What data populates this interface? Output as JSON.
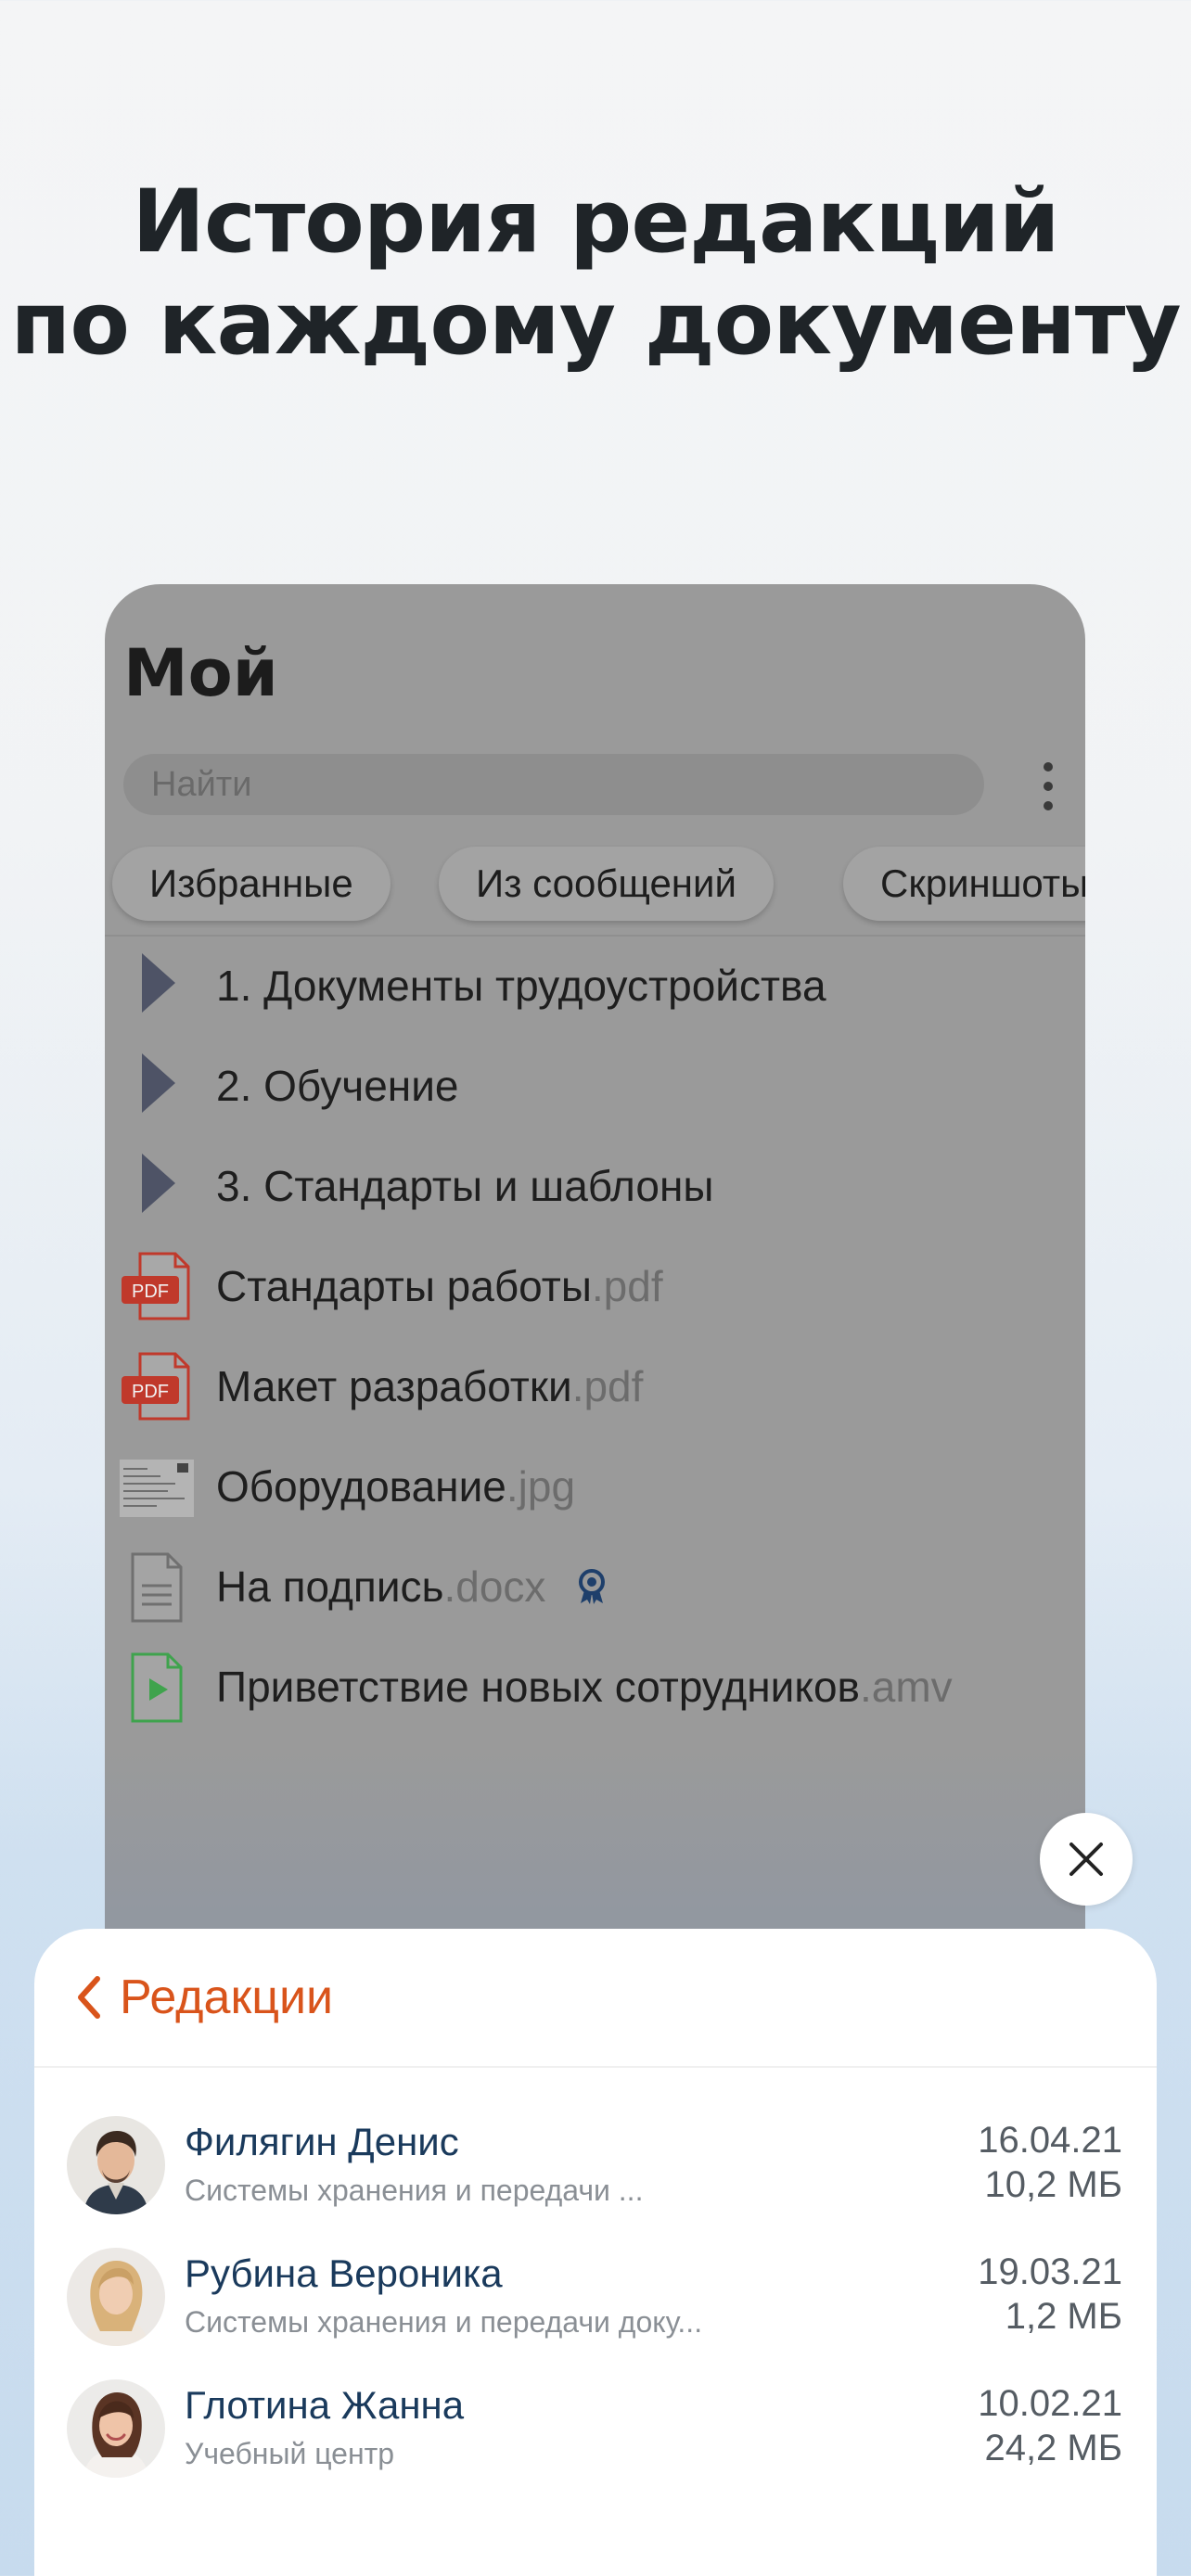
{
  "headline": {
    "line1": "История редакций",
    "line2": "по каждому документу"
  },
  "panel": {
    "title": "Мой",
    "search_placeholder": "Найти",
    "chips": [
      "Избранные",
      "Из сообщений",
      "Скриншоты"
    ],
    "items": [
      {
        "type": "folder",
        "name": "1. Документы трудоустройства",
        "ext": ""
      },
      {
        "type": "folder",
        "name": "2. Обучение",
        "ext": ""
      },
      {
        "type": "folder",
        "name": "3. Стандарты и шаблоны",
        "ext": ""
      },
      {
        "type": "pdf",
        "name": "Стандарты работы",
        "ext": ".pdf",
        "icon_label": "PDF"
      },
      {
        "type": "pdf",
        "name": "Макет разработки",
        "ext": ".pdf",
        "icon_label": "PDF"
      },
      {
        "type": "image",
        "name": "Оборудование",
        "ext": ".jpg"
      },
      {
        "type": "doc",
        "name": "На подпись",
        "ext": ".docx",
        "signed": true
      },
      {
        "type": "video",
        "name": "Приветствие новых сотрудников",
        "ext": ".amv"
      }
    ]
  },
  "sheet": {
    "title": "Редакции",
    "revisions": [
      {
        "name": "Филягин Денис",
        "subtitle": "Системы хранения и передачи ...",
        "date": "16.04.21",
        "size": "10,2 МБ"
      },
      {
        "name": "Рубина Вероника",
        "subtitle": "Системы хранения и передачи доку...",
        "date": "19.03.21",
        "size": "1,2 МБ"
      },
      {
        "name": "Глотина Жанна",
        "subtitle": "Учебный центр",
        "date": "10.02.21",
        "size": "24,2 МБ"
      }
    ]
  },
  "colors": {
    "accent": "#d9541b",
    "name_blue": "#1a3a5c",
    "folder_arrow": "#4e5366",
    "pdf_red": "#c0392b",
    "video_green": "#3fa34d"
  }
}
